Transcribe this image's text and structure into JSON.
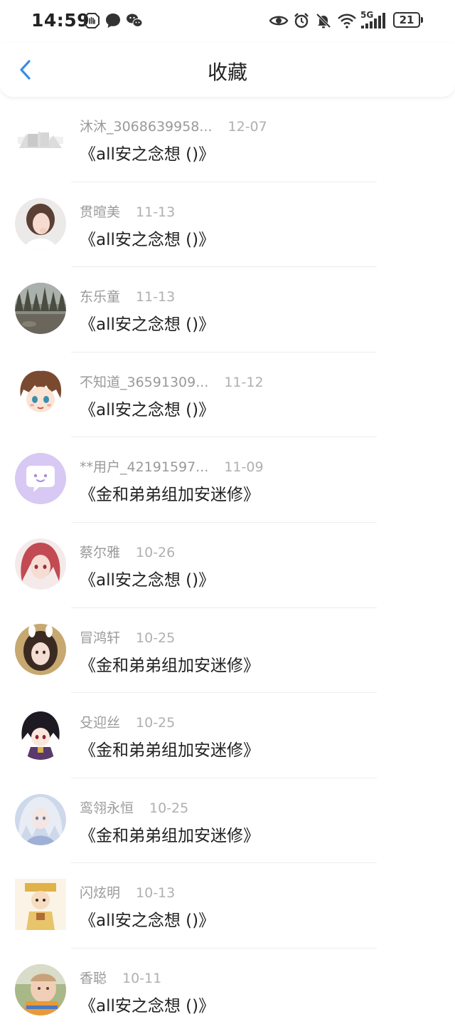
{
  "status_bar": {
    "time": "14:59",
    "network": "5G",
    "battery": "21",
    "icons": [
      "hand-icon",
      "message-bubble-icon",
      "wechat-icon",
      "eye-icon",
      "alarm-icon",
      "bell-off-icon",
      "wifi-icon",
      "signal-icon",
      "battery-icon"
    ]
  },
  "header": {
    "title": "收藏",
    "back_icon": "chevron-left-icon",
    "accent": "#3a8ee6"
  },
  "favorites": [
    {
      "username": "沐沐_3068639958...",
      "date": "12-07",
      "content": "《all安之念想 ()》",
      "avatar": "landscape-photo"
    },
    {
      "username": "贯暄美",
      "date": "11-13",
      "content": "《all安之念想 ()》",
      "avatar": "girl-photo"
    },
    {
      "username": "东乐童",
      "date": "11-13",
      "content": "《all安之念想 ()》",
      "avatar": "forest-photo"
    },
    {
      "username": "不知道_36591309...",
      "date": "11-12",
      "content": "《all安之念想 ()》",
      "avatar": "anime-boy"
    },
    {
      "username": "**用户_42191597...",
      "date": "11-09",
      "content": "《金和弟弟组加安迷修》",
      "avatar": "default-chat"
    },
    {
      "username": "蔡尔雅",
      "date": "10-26",
      "content": "《all安之念想 ()》",
      "avatar": "anime-red-hair"
    },
    {
      "username": "冒鸿轩",
      "date": "10-25",
      "content": "《金和弟弟组加安迷修》",
      "avatar": "bunny-girl"
    },
    {
      "username": "殳迎丝",
      "date": "10-25",
      "content": "《金和弟弟组加安迷修》",
      "avatar": "anime-dark"
    },
    {
      "username": "鸾翎永恒",
      "date": "10-25",
      "content": "《金和弟弟组加安迷修》",
      "avatar": "anime-silver"
    },
    {
      "username": "闪炫明",
      "date": "10-13",
      "content": "《all安之念想 ()》",
      "avatar": "cartoon-yellow"
    },
    {
      "username": "香聪",
      "date": "10-11",
      "content": "《all安之念想 ()》",
      "avatar": "child-photo"
    }
  ]
}
